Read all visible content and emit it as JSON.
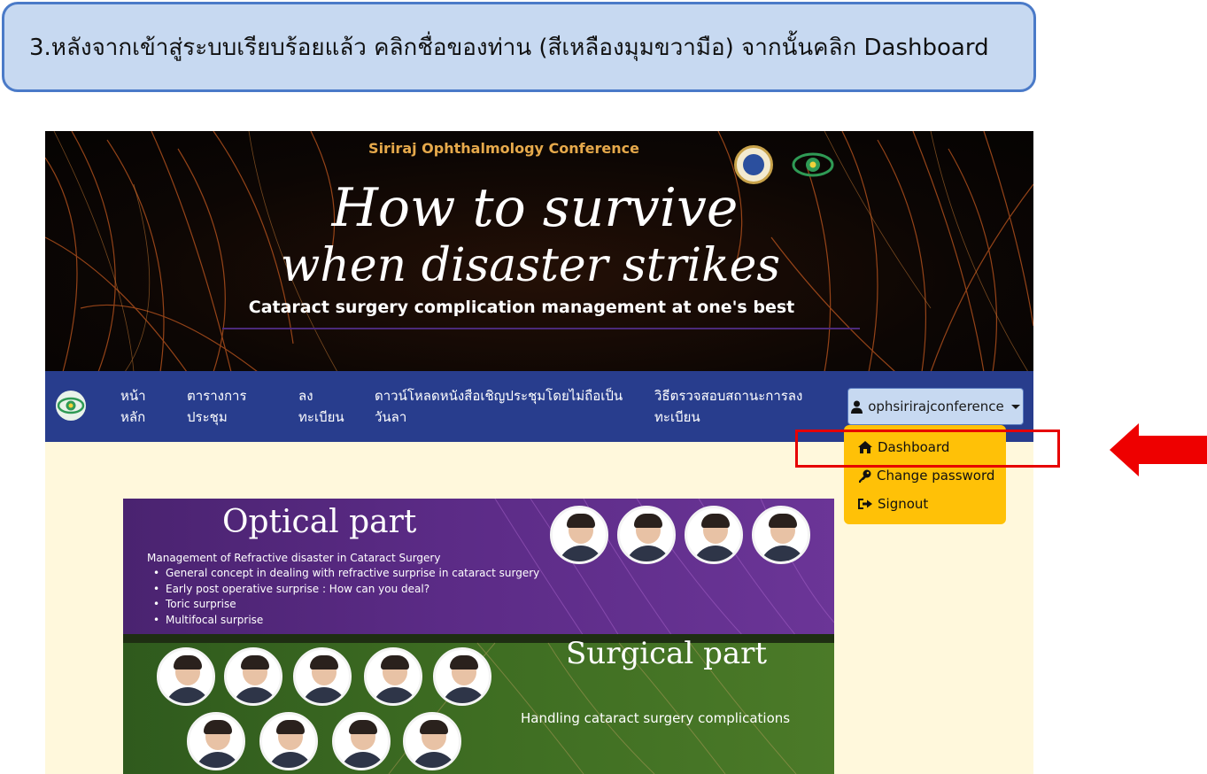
{
  "instruction": {
    "text": "3.หลังจากเข้าสู่ระบบเรียบร้อยแล้ว คลิกชื่อของท่าน (สีเหลืองมุมขวามือ) จากนั้นคลิก Dashboard"
  },
  "banner": {
    "conference": "Siriraj Ophthalmology Conference",
    "title_line1": "How to survive",
    "title_line2": "when disaster strikes",
    "subtitle": "Cataract surgery complication management at one's best"
  },
  "nav": {
    "items": [
      {
        "line1": "หน้า",
        "line2": "หลัก"
      },
      {
        "line1": "ตารางการ",
        "line2": "ประชุม"
      },
      {
        "line1": "ลง",
        "line2": "ทะเบียน"
      },
      {
        "line1": "ดาวน์โหลดหนังสือเชิญประชุมโดยไม่ถือเป็น",
        "line2": "วันลา"
      },
      {
        "line1": "วิธีตรวจสอบสถานะการลง",
        "line2": "ทะเบียน"
      }
    ],
    "user": "ophsirirajconference"
  },
  "dropdown": {
    "items": [
      {
        "label": "Dashboard",
        "icon": "home-icon"
      },
      {
        "label": "Change password",
        "icon": "key-icon"
      },
      {
        "label": "Signout",
        "icon": "sign-out-icon"
      }
    ]
  },
  "poster": {
    "optical_title": "Optical part",
    "optical_subtitle": "Management of Refractive disaster in Cataract Surgery",
    "optical_points": [
      "General concept in dealing with refractive surprise in cataract surgery",
      "Early post operative surprise : How can you deal?",
      "Toric surprise",
      "Multifocal surprise"
    ],
    "surgical_title": "Surgical part",
    "surgical_subtitle": "Handling cataract surgery complications"
  },
  "colors": {
    "instruction_bg": "#c7d9f1",
    "navbar": "#283d8d",
    "dropdown": "#ffc107",
    "highlight": "#e60000"
  }
}
